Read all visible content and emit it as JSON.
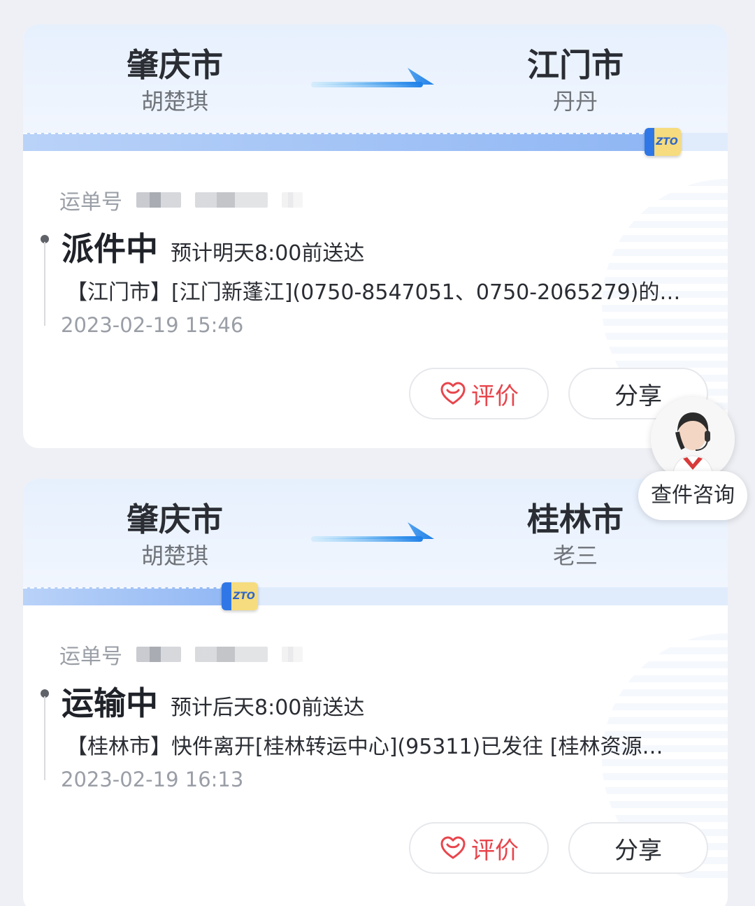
{
  "shipments": [
    {
      "from_city": "肇庆市",
      "from_person": "胡楚琪",
      "to_city": "江门市",
      "to_person": "丹丹",
      "progress": 0.91,
      "badge": "ZTO",
      "waybill_label": "运单号",
      "status": "派件中",
      "eta": "预计明天8:00前送达",
      "detail": "【江门市】[江门新蓬江](0750-8547051、0750-2065279)的…",
      "time": "2023-02-19 15:46",
      "rate_label": "评价",
      "share_label": "分享"
    },
    {
      "from_city": "肇庆市",
      "from_person": "胡楚琪",
      "to_city": "桂林市",
      "to_person": "老三",
      "progress": 0.31,
      "badge": "ZTO",
      "waybill_label": "运单号",
      "status": "运输中",
      "eta": "预计后天8:00前送达",
      "detail": "【桂林市】快件离开[桂林转运中心](95311)已发往 [桂林资源…",
      "time": "2023-02-19 16:13",
      "rate_label": "评价",
      "share_label": "分享"
    }
  ],
  "service": {
    "label": "查件咨询"
  },
  "colors": {
    "accent": "#2f77e6",
    "rate": "#e8454c"
  }
}
